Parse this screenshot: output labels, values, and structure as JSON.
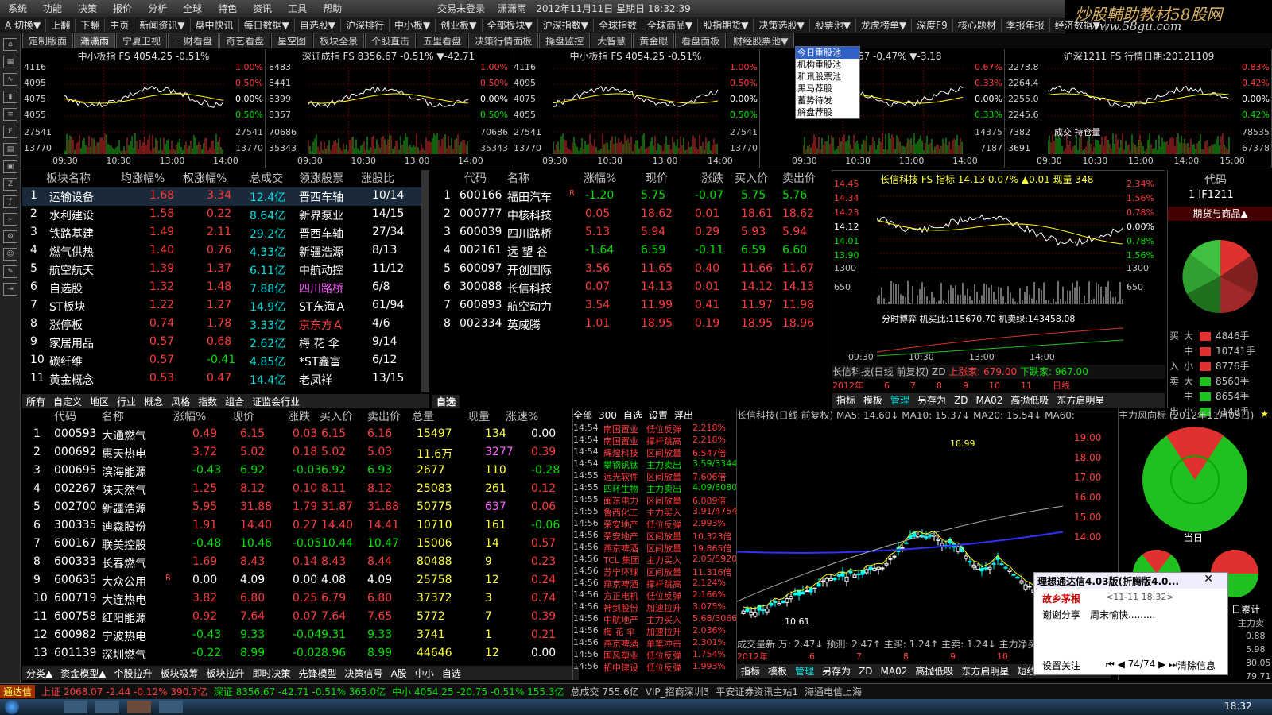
{
  "app": {
    "login_status": "交易未登录",
    "user": "潇潇雨",
    "datetime": "2012年11月11日 星期日 18:32:39"
  },
  "menu": [
    "系统",
    "功能",
    "决策",
    "报价",
    "分析",
    "全球",
    "特色",
    "资讯",
    "工具",
    "帮助"
  ],
  "menu_right": [
    "闪电手",
    "信息",
    "行"
  ],
  "logo": {
    "line1": "炒股輔助教材58股网",
    "line2": "www.58gu.com"
  },
  "toolbar": [
    "A 切换▼",
    "上翻",
    "下翻",
    "主页",
    "新闻资讯▼",
    "盘中快讯",
    "每日数据▼",
    "自选股▼",
    "沪深排行",
    "中小板▼",
    "创业板▼",
    "全部板块▼",
    "沪深指数▼",
    "全球指数",
    "全球商品▼",
    "股指期货▼",
    "决策选股▼",
    "股票池▼",
    "龙虎榜单▼",
    "深度F9",
    "核心题材",
    "季报年报",
    "经济数据▼"
  ],
  "tabs": [
    "定制版面",
    "潇潇雨",
    "宁夏卫视",
    "一财看盘",
    "奇艺看盘",
    "星空图",
    "板块全景",
    "个股直击",
    "五里看盘",
    "决策行情面板",
    "操盘监控",
    "大智慧",
    "黄金眼",
    "看盘面板",
    "财经股票池▼"
  ],
  "dropdown": [
    "今日重股池",
    "机构重股池",
    "和讯股票池",
    "黑马荐股",
    "蓄势待发",
    "解盘荐股"
  ],
  "minicharts": [
    {
      "title": "中小板指  FS 4054.25 -0.51%",
      "yl": [
        "4116",
        "4095",
        "4075",
        "4055",
        "27541",
        "13770"
      ],
      "yr": [
        "1.00%",
        "0.50%",
        "0.00%",
        "0.50%",
        "27541",
        "13770"
      ],
      "x": [
        "09:30",
        "10:30",
        "13:00",
        "14:00"
      ]
    },
    {
      "title": "深证成指  FS 8356.67 -0.51% ▼-42.71",
      "yl": [
        "8483",
        "8441",
        "8399",
        "8357",
        "70686",
        "35343"
      ],
      "yr": [
        "1.00%",
        "0.50%",
        "0.00%",
        "0.50%",
        "70686",
        "35343"
      ],
      "x": [
        "09:30",
        "10:30",
        "13:00",
        "14:00"
      ]
    },
    {
      "title": "中小板指  FS 4054.25 -0.51%",
      "yl": [
        "4116",
        "4095",
        "4075",
        "4055",
        "27541",
        "13770"
      ],
      "yr": [
        "1.00%",
        "0.50%",
        "0.00%",
        "0.50%",
        "27541",
        "13770"
      ],
      "x": [
        "09:30",
        "10:30",
        "13:00",
        "14:00"
      ]
    },
    {
      "title": "指   672.67 -0.47% ▼-3.18",
      "yl": [
        "",
        "",
        "",
        "",
        "",
        ""
      ],
      "yr": [
        "0.67%",
        "0.33%",
        "0.00%",
        "0.33%",
        "14375",
        "7187"
      ],
      "x": [
        "09:30",
        "10:30",
        "13:00",
        "14:00"
      ]
    },
    {
      "title": "沪深1211  FS 行情日期:20121109",
      "yl": [
        "2273.8",
        "2264.4",
        "2255.0",
        "2245.6",
        "7382",
        "3691"
      ],
      "yr": [
        "0.83%",
        "0.42%",
        "0.00%",
        "0.42%",
        "78535",
        "67378"
      ],
      "x": [
        "09:30",
        "10:30",
        "13:00",
        "14:00",
        "15:00"
      ],
      "note": "成交 持仓量"
    }
  ],
  "sector": {
    "headers": [
      "板块名称",
      "均涨幅%",
      "权涨幅%",
      "总成交",
      "领涨股票",
      "涨股比"
    ],
    "rows": [
      [
        "1",
        "运输设备",
        "1.68",
        "3.34",
        "12.4亿",
        "晋西车轴",
        "10/14"
      ],
      [
        "2",
        "水利建设",
        "1.58",
        "0.22",
        "8.64亿",
        "新界泵业",
        "14/15"
      ],
      [
        "3",
        "铁路基建",
        "1.49",
        "2.11",
        "29.2亿",
        "晋西车轴",
        "27/34"
      ],
      [
        "4",
        "燃气供热",
        "1.40",
        "0.76",
        "4.33亿",
        "新疆浩源",
        "8/13"
      ],
      [
        "5",
        "航空航天",
        "1.39",
        "1.37",
        "6.11亿",
        "中航动控",
        "11/12"
      ],
      [
        "6",
        "自选股",
        "1.32",
        "1.48",
        "7.88亿",
        "四川路桥",
        "6/8"
      ],
      [
        "7",
        "ST板块",
        "1.22",
        "1.27",
        "14.9亿",
        "ST东海Ａ",
        "61/94"
      ],
      [
        "8",
        "涨停板",
        "0.74",
        "1.78",
        "3.33亿",
        "京东方Ａ",
        "4/6"
      ],
      [
        "9",
        "家居用品",
        "0.57",
        "0.68",
        "2.62亿",
        "梅 花 伞",
        "9/14"
      ],
      [
        "10",
        "碳纤维",
        "0.57",
        "-0.41",
        "4.85亿",
        "*ST鑫富",
        "6/12"
      ],
      [
        "11",
        "黄金概念",
        "0.53",
        "0.47",
        "14.4亿",
        "老凤祥",
        "13/15"
      ]
    ],
    "tabs": [
      "所有",
      "自定义",
      "地区",
      "行业",
      "概念",
      "风格",
      "指数",
      "组合",
      "证监会行业"
    ]
  },
  "watch": {
    "headers": [
      "代码",
      "名称",
      "涨幅%",
      "现价",
      "涨跌",
      "买入价",
      "卖出价"
    ],
    "rows": [
      [
        "1",
        "600166",
        "福田汽车",
        "R",
        "-1.20",
        "5.75",
        "-0.07",
        "5.75",
        "5.76"
      ],
      [
        "2",
        "000777",
        "中核科技",
        "",
        "0.05",
        "18.62",
        "0.01",
        "18.61",
        "18.62"
      ],
      [
        "3",
        "600039",
        "四川路桥",
        "",
        "5.13",
        "5.94",
        "0.29",
        "5.93",
        "5.94"
      ],
      [
        "4",
        "002161",
        "远 望 谷",
        "",
        "-1.64",
        "6.59",
        "-0.11",
        "6.59",
        "6.60"
      ],
      [
        "5",
        "600097",
        "开创国际",
        "",
        "3.56",
        "11.65",
        "0.40",
        "11.66",
        "11.67"
      ],
      [
        "6",
        "300088",
        "长信科技",
        "",
        "0.07",
        "14.13",
        "0.01",
        "14.12",
        "14.13"
      ],
      [
        "7",
        "600893",
        "航空动力",
        "",
        "3.54",
        "11.99",
        "0.41",
        "11.97",
        "11.98"
      ],
      [
        "8",
        "002334",
        "英威腾",
        "",
        "1.01",
        "18.95",
        "0.19",
        "18.95",
        "18.96"
      ]
    ],
    "tab": "自选"
  },
  "stockchart": {
    "title": "长信科技  FS 指标 14.13 0.07% ▲0.01 现量 348",
    "yl": [
      "14.45",
      "14.34",
      "14.23",
      "14.12",
      "14.01",
      "13.90",
      "1300",
      "650"
    ],
    "yr": [
      "2.34%",
      "1.56%",
      "0.78%",
      "0.00%",
      "0.78%",
      "1.56%",
      "1300",
      "650"
    ],
    "x": [
      "09:30",
      "10:30",
      "13:00",
      "14:00"
    ],
    "note": "分时博弈 机买此:115670.70 机卖绿:143458.08",
    "kline": "长信科技(日线 前复权) ZD",
    "up": "上涨家: 679.00",
    "down": "下跌家: 967.00",
    "dates": [
      "2012年",
      "6",
      "7",
      "8",
      "9",
      "10",
      "11",
      "日线"
    ],
    "tabs": [
      "指标",
      "模板",
      "管理",
      "另存为",
      "ZD",
      "MA02",
      "高抛低吸",
      "东方启明星"
    ]
  },
  "rightpanel": {
    "code_hdr": "代码",
    "code": "1  IF1211",
    "title": "期货与商品▲",
    "buy": [
      [
        "买",
        "大",
        "4846手"
      ],
      [
        "",
        "中",
        "10741手"
      ],
      [
        "入",
        "小",
        "8776手"
      ]
    ],
    "sell": [
      [
        "卖",
        "大",
        "8560手"
      ],
      [
        "",
        "中",
        "8654手"
      ],
      [
        "出",
        "小",
        "7148手"
      ]
    ]
  },
  "gas": {
    "headers": [
      "代码",
      "名称",
      "涨幅%",
      "现价",
      "涨跌",
      "买入价",
      "卖出价",
      "总量",
      "现量",
      "涨速%"
    ],
    "rows": [
      [
        "1",
        "000593",
        "大通燃气",
        "",
        "0.49",
        "6.15",
        "0.03",
        "6.15",
        "6.16",
        "15497",
        "134",
        "0.00"
      ],
      [
        "2",
        "000692",
        "惠天热电",
        "",
        "3.72",
        "5.02",
        "0.18",
        "5.02",
        "5.03",
        "11.6万",
        "3277",
        "0.39"
      ],
      [
        "3",
        "000695",
        "滨海能源",
        "",
        "-0.43",
        "6.92",
        "-0.03",
        "6.92",
        "6.93",
        "2677",
        "110",
        "-0.28"
      ],
      [
        "4",
        "002267",
        "陕天然气",
        "",
        "1.25",
        "8.12",
        "0.10",
        "8.11",
        "8.12",
        "25083",
        "261",
        "0.12"
      ],
      [
        "5",
        "002700",
        "新疆浩源",
        "",
        "5.95",
        "31.88",
        "1.79",
        "31.87",
        "31.88",
        "50775",
        "637",
        "0.06"
      ],
      [
        "6",
        "300335",
        "迪森股份",
        "",
        "1.91",
        "14.40",
        "0.27",
        "14.40",
        "14.41",
        "10710",
        "161",
        "-0.06"
      ],
      [
        "7",
        "600167",
        "联美控股",
        "",
        "-0.48",
        "10.46",
        "-0.05",
        "10.44",
        "10.47",
        "15006",
        "14",
        "0.57"
      ],
      [
        "8",
        "600333",
        "长春燃气",
        "",
        "1.69",
        "8.43",
        "0.14",
        "8.43",
        "8.44",
        "80488",
        "9",
        "0.23"
      ],
      [
        "9",
        "600635",
        "大众公用",
        "R",
        "0.00",
        "4.09",
        "0.00",
        "4.08",
        "4.09",
        "25758",
        "12",
        "0.24"
      ],
      [
        "10",
        "600719",
        "大连热电",
        "",
        "3.82",
        "6.80",
        "0.25",
        "6.79",
        "6.80",
        "37372",
        "3",
        "0.74"
      ],
      [
        "11",
        "600758",
        "红阳能源",
        "",
        "0.92",
        "7.64",
        "0.07",
        "7.64",
        "7.65",
        "5772",
        "7",
        "0.39"
      ],
      [
        "12",
        "600982",
        "宁波热电",
        "",
        "-0.43",
        "9.33",
        "-0.04",
        "9.31",
        "9.33",
        "3741",
        "1",
        "0.21"
      ],
      [
        "13",
        "601139",
        "深圳燃气",
        "",
        "-0.22",
        "8.99",
        "-0.02",
        "8.96",
        "8.99",
        "44646",
        "12",
        "0.00"
      ]
    ],
    "tabs": [
      "分类▲",
      "资金模型▲",
      "个股拉升",
      "板块吸筹",
      "板块拉升",
      "即时决策",
      "先锋模型",
      "决策信号",
      "A股",
      "中小",
      "自选"
    ]
  },
  "alerts": {
    "tabs": [
      "全部",
      "300",
      "自选",
      "设置",
      "浮出"
    ],
    "rows": [
      [
        "14:54",
        "南国置业",
        "低位反弹",
        "2.218%"
      ],
      [
        "14:54",
        "南国置业",
        "撑杆跳高",
        "2.218%"
      ],
      [
        "14:54",
        "辉煌科技",
        "区间放量",
        "6.547倍"
      ],
      [
        "14:54",
        "攀钢钒钛",
        "主力卖出",
        "3.59/3344"
      ],
      [
        "14:55",
        "远光软件",
        "区间放量",
        "7.606倍"
      ],
      [
        "14:55",
        "四环生物",
        "主力卖出",
        "4.09/6080"
      ],
      [
        "14:55",
        "闽东电力",
        "区间放量",
        "6.089倍"
      ],
      [
        "14:55",
        "鲁西化工",
        "主力买入",
        "3.91/4754"
      ],
      [
        "14:56",
        "荣安地产",
        "低位反弹",
        "2.993%"
      ],
      [
        "14:56",
        "荣安地产",
        "区间放量",
        "10.323倍"
      ],
      [
        "14:56",
        "燕京啤酒",
        "区间放量",
        "19.865倍"
      ],
      [
        "14:56",
        "TCL 集团",
        "主力买入",
        "2.05/5920"
      ],
      [
        "14:56",
        "苏宁环球",
        "区间放量",
        "11.316倍"
      ],
      [
        "14:56",
        "燕京啤酒",
        "撑杆跳高",
        "2.124%"
      ],
      [
        "14:56",
        "方正电机",
        "低位反弹",
        "2.166%"
      ],
      [
        "14:56",
        "神剑股份",
        "加速拉升",
        "3.075%"
      ],
      [
        "14:56",
        "中航地产",
        "主力买入",
        "5.68/3066"
      ],
      [
        "14:56",
        "梅 花 伞",
        "加速拉升",
        "2.036%"
      ],
      [
        "14:56",
        "燕京啤酒",
        "单笔冲击",
        "2.301%"
      ],
      [
        "14:56",
        "国风塑业",
        "低位反弹",
        "1.754%"
      ],
      [
        "14:56",
        "拓中建设",
        "低位反弹",
        "1.993%"
      ]
    ]
  },
  "kchart": {
    "title": "长信科技(日线 前复权) MA5: 14.60↓  MA10: 15.37↓  MA20: 15.54↓  MA60:",
    "y": [
      "19.00",
      "18.00",
      "17.00",
      "16.00",
      "15.00",
      "14.00"
    ],
    "hi": "18.99",
    "lo": "10.61",
    "bottom": "成交量新 万: 2.47↓  预测: 2.47↑  主买: 1.24↑  主卖: 1.24↓  主力净买",
    "dates": [
      "2012年",
      "6",
      "7",
      "8",
      "9",
      "10"
    ],
    "tabs": [
      "指标",
      "模板",
      "管理",
      "另存为",
      "ZD",
      "MA02",
      "高抛低吸",
      "东方启明星",
      "短线无敌"
    ]
  },
  "flow": {
    "title": "主力风向标 (2012年11月09日)",
    "today": "当日",
    "cum": "日累计",
    "vals": [
      "0.88",
      "5.98",
      "80.05",
      "79.71"
    ],
    "label_r": "主力卖"
  },
  "popup": {
    "title": "理想通达信4.03版(折腾版4.0...",
    "user": "故乡茅根",
    "time": "<11-11 18:32>",
    "msg1": "谢谢分享",
    "msg2": "周末愉快.........",
    "follow": "设置关注",
    "page": "74/74",
    "clear": "清除信息"
  },
  "status": {
    "app": "通达信",
    "sh": "上证 2068.07  -2.44  -0.12%  390.7亿",
    "sz": "深证 8356.67  -42.71  -0.51%  365.0亿",
    "zx": "中小 4054.25  -20.75  -0.51%  155.3亿",
    "total": "总成交  755.6亿",
    "vip": "VIP_招商深圳3",
    "news": "平安证券资讯主站1",
    "tel": "海通电信上海"
  },
  "taskbar": {
    "time": "18:32"
  }
}
